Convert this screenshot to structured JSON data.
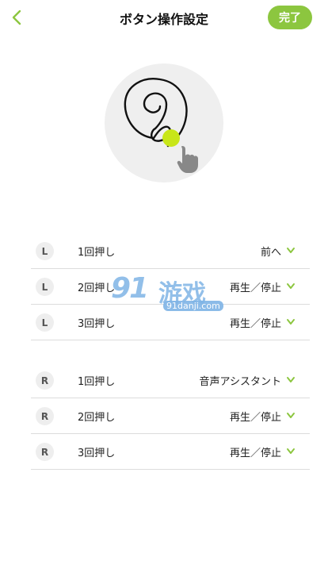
{
  "header": {
    "title": "ボタン操作設定",
    "done_label": "完了"
  },
  "left_group": {
    "side": "L",
    "rows": [
      {
        "press": "1回押し",
        "action": "前へ"
      },
      {
        "press": "2回押し",
        "action": "再生／停止"
      },
      {
        "press": "3回押し",
        "action": "再生／停止"
      }
    ]
  },
  "right_group": {
    "side": "R",
    "rows": [
      {
        "press": "1回押し",
        "action": "音声アシスタント"
      },
      {
        "press": "2回押し",
        "action": "再生／停止"
      },
      {
        "press": "3回押し",
        "action": "再生／停止"
      }
    ]
  },
  "watermark": {
    "number": "91",
    "name": "游戏",
    "site": "91danji.com"
  },
  "colors": {
    "accent": "#8cc63f",
    "highlight_dot": "#c8e619",
    "badge_bg": "#eeeeee",
    "divider": "#dcdcdc"
  },
  "icons": {
    "back": "chevron-left-icon",
    "dropdown": "chevron-down-icon",
    "hand": "hand-pointer-icon"
  }
}
